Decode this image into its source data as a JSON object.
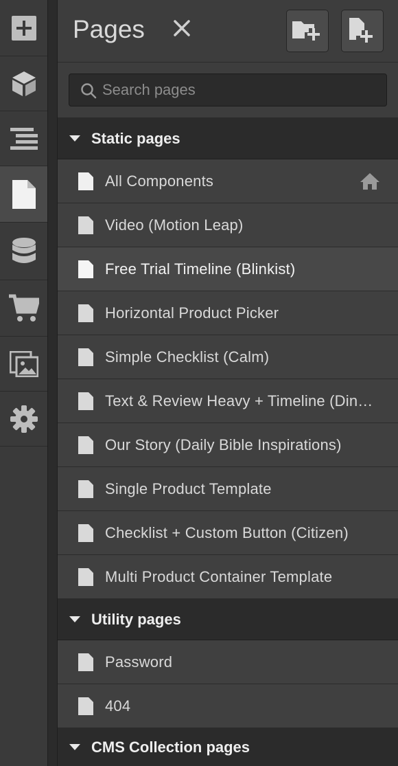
{
  "panel": {
    "title": "Pages",
    "search_placeholder": "Search pages"
  },
  "rail": {
    "items": [
      {
        "icon": "add-icon"
      },
      {
        "icon": "box-icon"
      },
      {
        "icon": "navigator-icon"
      },
      {
        "icon": "pages-icon",
        "active": true
      },
      {
        "icon": "database-icon"
      },
      {
        "icon": "cart-icon"
      },
      {
        "icon": "assets-icon"
      },
      {
        "icon": "settings-icon"
      }
    ]
  },
  "sections": {
    "static": "Static pages",
    "utility": "Utility pages",
    "cms": "CMS Collection pages"
  },
  "static_pages": [
    "All Components",
    "Video (Motion Leap)",
    "Free Trial Timeline (Blinkist)",
    "Horizontal Product Picker",
    "Simple Checklist (Calm)",
    "Text & Review Heavy + Timeline (Dinkles)",
    "Our Story (Daily Bible Inspirations)",
    "Single Product Template",
    "Checklist + Custom Button (Citizen)",
    "Multi Product Container Template"
  ],
  "utility_pages": [
    "Password",
    "404"
  ],
  "colors": {
    "panel": "#404040",
    "section": "#2b2b2b",
    "text": "#d9d9d9"
  }
}
